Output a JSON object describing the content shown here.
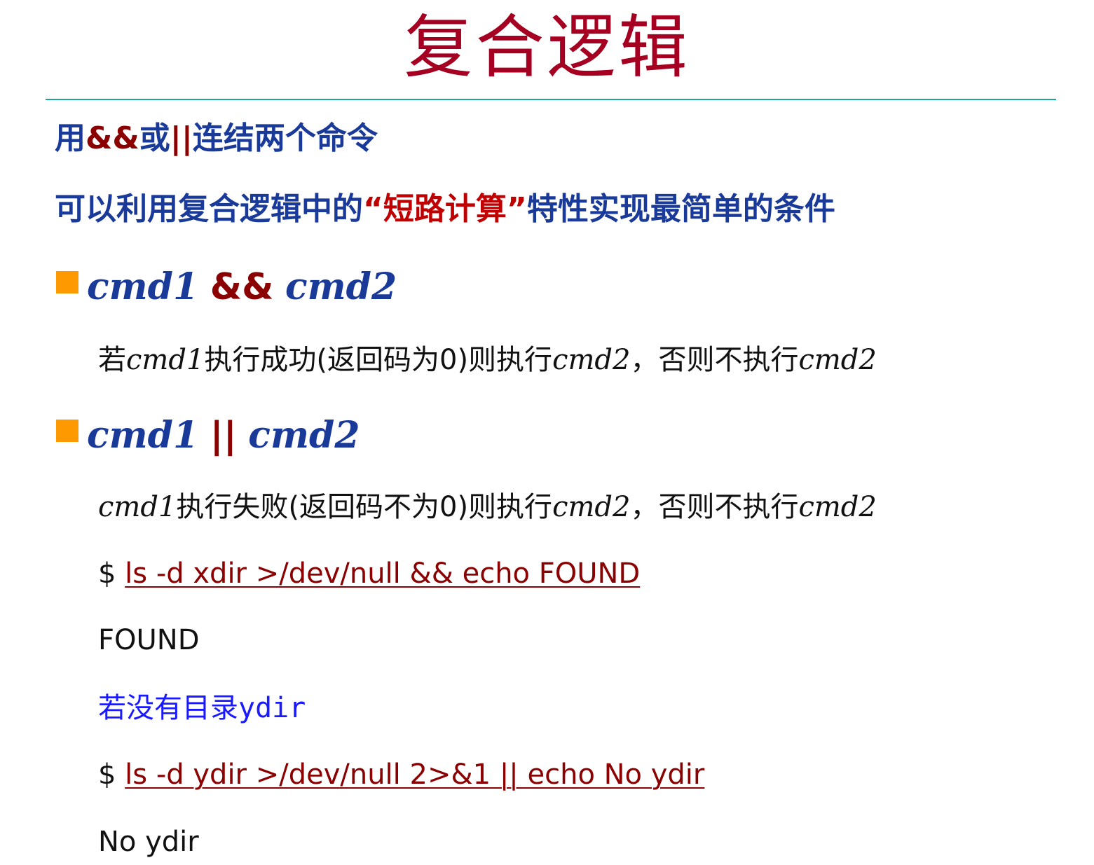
{
  "title": "复合逻辑",
  "intro": {
    "line1": {
      "prefix": "用",
      "op1": "&&",
      "mid": "或",
      "op2": "||",
      "suffix": "连结两个命令"
    },
    "line2": {
      "prefix": "可以利用复合逻辑中的",
      "highlight": "“短路计算”",
      "suffix": "特性实现最简单的条件"
    }
  },
  "sections": [
    {
      "cmd1": "cmd1",
      "operator": "&&",
      "cmd2": "cmd2",
      "desc": {
        "p1": "若",
        "c1": "cmd1",
        "p2": "执行成功(返回码为0)则执行",
        "c2": "cmd2",
        "p3": "，否则不执行",
        "c3": "cmd2"
      }
    },
    {
      "cmd1": "cmd1",
      "operator": "||",
      "cmd2": "cmd2",
      "desc": {
        "c1": "cmd1",
        "p2": "执行失败(返回码不为0)则执行",
        "c2": "cmd2",
        "p3": "，否则不执行",
        "c3": "cmd2"
      }
    }
  ],
  "examples": {
    "prompt": "$",
    "cmd1": "ls -d xdir >/dev/null && echo FOUND",
    "out1": "FOUND",
    "note_cn": "若没有目录",
    "note_mono": "ydir",
    "cmd2": "ls -d ydir >/dev/null 2>&1 || echo No ydir",
    "out2": "No ydir"
  },
  "colors": {
    "title": "#a50021",
    "heading_blue": "#1a3a9a",
    "operator_red": "#8b0000",
    "highlight_red": "#c00000",
    "bullet": "#ff9900",
    "rule": "#1aa896",
    "note_blue": "#1a1aff"
  },
  "icons": {
    "bullet": "orange-square-bullet-icon"
  }
}
